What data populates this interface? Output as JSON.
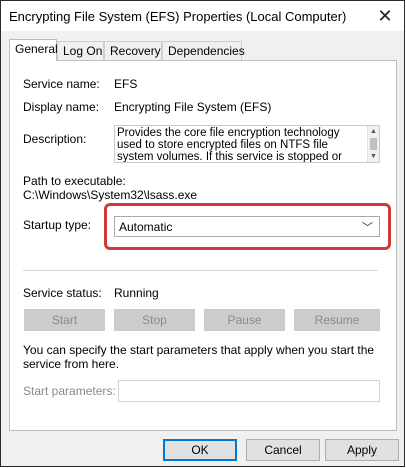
{
  "window": {
    "title": "Encrypting File System (EFS) Properties (Local Computer)"
  },
  "tabs": [
    "General",
    "Log On",
    "Recovery",
    "Dependencies"
  ],
  "general": {
    "service_name_label": "Service name:",
    "service_name": "EFS",
    "display_name_label": "Display name:",
    "display_name": "Encrypting File System (EFS)",
    "description_label": "Description:",
    "description": "Provides the core file encryption technology used to store encrypted files on NTFS file system volumes. If this service is stopped or disabled, applications will",
    "path_label": "Path to executable:",
    "path": "C:\\Windows\\System32\\lsass.exe",
    "startup_type_label": "Startup type:",
    "startup_type": "Automatic",
    "service_status_label": "Service status:",
    "service_status": "Running",
    "buttons": {
      "start": "Start",
      "stop": "Stop",
      "pause": "Pause",
      "resume": "Resume"
    },
    "info_text": "You can specify the start parameters that apply when you start the service from here.",
    "start_params_label": "Start parameters:",
    "start_params_value": ""
  },
  "dialog_buttons": {
    "ok": "OK",
    "cancel": "Cancel",
    "apply": "Apply"
  },
  "colors": {
    "highlight": "#d2373a",
    "default_button_border": "#0078d7"
  }
}
